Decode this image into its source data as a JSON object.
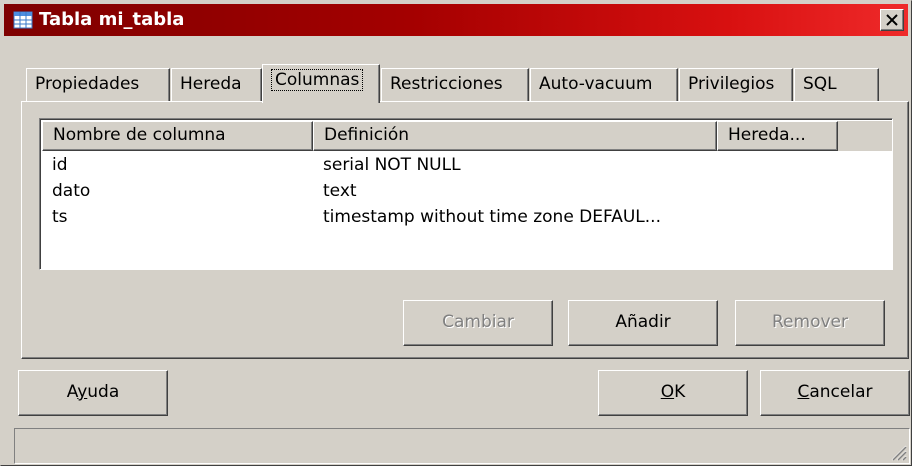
{
  "window": {
    "title": "Tabla mi_tabla"
  },
  "tabs": [
    {
      "label": "Propiedades"
    },
    {
      "label": "Hereda"
    },
    {
      "label": "Columnas"
    },
    {
      "label": "Restricciones"
    },
    {
      "label": "Auto-vacuum"
    },
    {
      "label": "Privilegios"
    },
    {
      "label": "SQL"
    }
  ],
  "active_tab": "Columnas",
  "columns_list": {
    "headers": [
      "Nombre de columna",
      "Definición",
      "Hereda..."
    ],
    "rows": [
      {
        "name": "id",
        "definition": "serial NOT NULL",
        "inherits": ""
      },
      {
        "name": "dato",
        "definition": "text",
        "inherits": ""
      },
      {
        "name": "ts",
        "definition": "timestamp without time zone DEFAUL...",
        "inherits": ""
      }
    ]
  },
  "panel_buttons": {
    "change": "Cambiar",
    "add": "Añadir",
    "remove": "Remover"
  },
  "dialog_buttons": {
    "help_pre": "A",
    "help_key": "y",
    "help_post": "uda",
    "ok_key": "O",
    "ok_post": "K",
    "cancel_key": "C",
    "cancel_post": "ancelar"
  },
  "statusbar": {
    "text": ""
  },
  "colors": {
    "title_gradient_start": "#7e0000",
    "title_gradient_end": "#ef2a2a",
    "face": "#d4d0c8"
  }
}
